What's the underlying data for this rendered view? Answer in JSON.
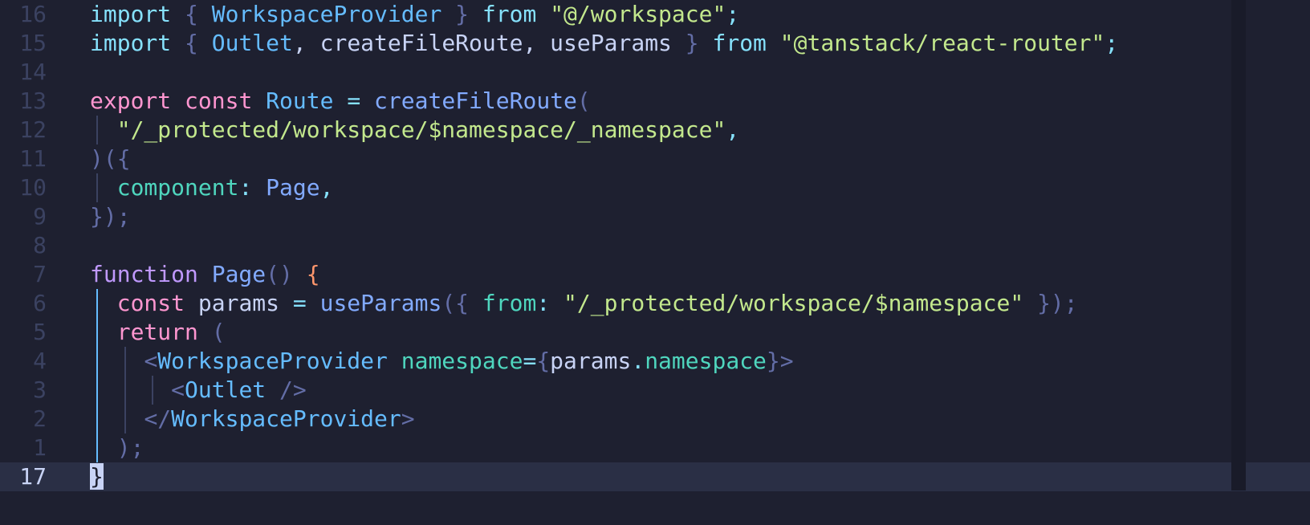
{
  "editor": {
    "colors": {
      "background": "#1e2030",
      "cursorline": "#2a2f45",
      "line_number": "#3b4261",
      "current_line_number": "#c8d3f5"
    },
    "lines": [
      {
        "number": "16",
        "tokens": [
          {
            "text": "import",
            "color": "#86e1fc"
          },
          {
            "text": " ",
            "color": "#c8d3f5"
          },
          {
            "text": "{",
            "color": "#636da6"
          },
          {
            "text": " WorkspaceProvider ",
            "color": "#65bcff"
          },
          {
            "text": "}",
            "color": "#636da6"
          },
          {
            "text": " from ",
            "color": "#86e1fc"
          },
          {
            "text": "\"@/workspace\"",
            "color": "#c3e88d"
          },
          {
            "text": ";",
            "color": "#86e1fc"
          }
        ]
      },
      {
        "number": "15",
        "tokens": [
          {
            "text": "import",
            "color": "#86e1fc"
          },
          {
            "text": " ",
            "color": "#c8d3f5"
          },
          {
            "text": "{",
            "color": "#636da6"
          },
          {
            "text": " Outlet",
            "color": "#65bcff"
          },
          {
            "text": ",",
            "color": "#c8d3f5"
          },
          {
            "text": " createFileRoute",
            "color": "#c8d3f5"
          },
          {
            "text": ",",
            "color": "#c8d3f5"
          },
          {
            "text": " useParams ",
            "color": "#c8d3f5"
          },
          {
            "text": "}",
            "color": "#636da6"
          },
          {
            "text": " from ",
            "color": "#86e1fc"
          },
          {
            "text": "\"@tanstack/react-router\"",
            "color": "#c3e88d"
          },
          {
            "text": ";",
            "color": "#86e1fc"
          }
        ]
      },
      {
        "number": "14",
        "tokens": []
      },
      {
        "number": "13",
        "tokens": [
          {
            "text": "export",
            "color": "#ff96d0"
          },
          {
            "text": " ",
            "color": "#c8d3f5"
          },
          {
            "text": "const",
            "color": "#ff96d0"
          },
          {
            "text": " ",
            "color": "#c8d3f5"
          },
          {
            "text": "Route",
            "color": "#65bcff"
          },
          {
            "text": " = ",
            "color": "#86e1fc"
          },
          {
            "text": "createFileRoute",
            "color": "#82aaff"
          },
          {
            "text": "(",
            "color": "#636da6"
          }
        ]
      },
      {
        "number": "12",
        "tokens": [
          {
            "text": "  ",
            "color": "#c8d3f5"
          },
          {
            "text": "\"/_protected/workspace/$namespace/_namespace\"",
            "color": "#c3e88d"
          },
          {
            "text": ",",
            "color": "#86e1fc"
          }
        ]
      },
      {
        "number": "11",
        "tokens": [
          {
            "text": ")(",
            "color": "#636da6"
          },
          {
            "text": "{",
            "color": "#636da6"
          }
        ]
      },
      {
        "number": "10",
        "tokens": [
          {
            "text": "  ",
            "color": "#c8d3f5"
          },
          {
            "text": "component",
            "color": "#4fd6be"
          },
          {
            "text": ": ",
            "color": "#86e1fc"
          },
          {
            "text": "Page",
            "color": "#82aaff"
          },
          {
            "text": ",",
            "color": "#86e1fc"
          }
        ]
      },
      {
        "number": "9",
        "tokens": [
          {
            "text": "}",
            "color": "#636da6"
          },
          {
            "text": ");",
            "color": "#636da6"
          }
        ]
      },
      {
        "number": "8",
        "tokens": []
      },
      {
        "number": "7",
        "tokens": [
          {
            "text": "function",
            "color": "#c099ff"
          },
          {
            "text": " ",
            "color": "#c8d3f5"
          },
          {
            "text": "Page",
            "color": "#82aaff"
          },
          {
            "text": "()",
            "color": "#636da6"
          },
          {
            "text": " ",
            "color": "#c8d3f5"
          },
          {
            "text": "{",
            "color": "#ff966c"
          }
        ]
      },
      {
        "number": "6",
        "tokens": [
          {
            "text": "  ",
            "color": "#c8d3f5"
          },
          {
            "text": "const",
            "color": "#ff96d0"
          },
          {
            "text": " params ",
            "color": "#c8d3f5"
          },
          {
            "text": "=",
            "color": "#86e1fc"
          },
          {
            "text": " ",
            "color": "#c8d3f5"
          },
          {
            "text": "useParams",
            "color": "#82aaff"
          },
          {
            "text": "(",
            "color": "#636da6"
          },
          {
            "text": "{",
            "color": "#636da6"
          },
          {
            "text": " ",
            "color": "#c8d3f5"
          },
          {
            "text": "from",
            "color": "#4fd6be"
          },
          {
            "text": ": ",
            "color": "#86e1fc"
          },
          {
            "text": "\"/_protected/workspace/$namespace\"",
            "color": "#c3e88d"
          },
          {
            "text": " ",
            "color": "#c8d3f5"
          },
          {
            "text": "}",
            "color": "#636da6"
          },
          {
            "text": ");",
            "color": "#636da6"
          }
        ]
      },
      {
        "number": "5",
        "tokens": [
          {
            "text": "  ",
            "color": "#c8d3f5"
          },
          {
            "text": "return",
            "color": "#ff96d0"
          },
          {
            "text": " ",
            "color": "#c8d3f5"
          },
          {
            "text": "(",
            "color": "#636da6"
          }
        ]
      },
      {
        "number": "4",
        "tokens": [
          {
            "text": "    ",
            "color": "#c8d3f5"
          },
          {
            "text": "<",
            "color": "#636da6"
          },
          {
            "text": "WorkspaceProvider",
            "color": "#65bcff"
          },
          {
            "text": " ",
            "color": "#c8d3f5"
          },
          {
            "text": "namespace",
            "color": "#4fd6be"
          },
          {
            "text": "=",
            "color": "#86e1fc"
          },
          {
            "text": "{",
            "color": "#636da6"
          },
          {
            "text": "params",
            "color": "#c8d3f5"
          },
          {
            "text": ".",
            "color": "#86e1fc"
          },
          {
            "text": "namespace",
            "color": "#4fd6be"
          },
          {
            "text": "}",
            "color": "#636da6"
          },
          {
            "text": ">",
            "color": "#636da6"
          }
        ]
      },
      {
        "number": "3",
        "tokens": [
          {
            "text": "      ",
            "color": "#c8d3f5"
          },
          {
            "text": "<",
            "color": "#636da6"
          },
          {
            "text": "Outlet",
            "color": "#65bcff"
          },
          {
            "text": " ",
            "color": "#c8d3f5"
          },
          {
            "text": "/>",
            "color": "#636da6"
          }
        ]
      },
      {
        "number": "2",
        "tokens": [
          {
            "text": "    ",
            "color": "#c8d3f5"
          },
          {
            "text": "</",
            "color": "#636da6"
          },
          {
            "text": "WorkspaceProvider",
            "color": "#65bcff"
          },
          {
            "text": ">",
            "color": "#636da6"
          }
        ]
      },
      {
        "number": "1",
        "tokens": [
          {
            "text": "  ",
            "color": "#c8d3f5"
          },
          {
            "text": ");",
            "color": "#636da6"
          }
        ]
      },
      {
        "number": "17",
        "current": true,
        "tokens": [
          {
            "text": "}",
            "color": "#1e2030",
            "cursor": true
          }
        ]
      }
    ]
  }
}
